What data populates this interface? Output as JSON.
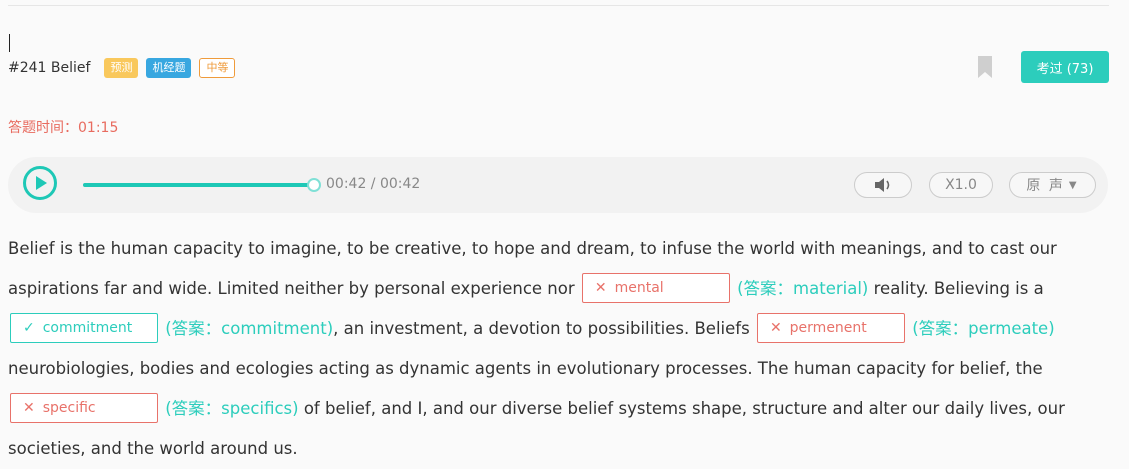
{
  "question": {
    "title": "#241 Belief",
    "tags": {
      "predict": "预测",
      "machine": "机经题",
      "level": "中等"
    },
    "exam_button": "考过 (73)"
  },
  "timer": "答题时间：01:15",
  "player": {
    "time": "00:42 / 00:42",
    "progress": 1.0,
    "speed": "X1.0",
    "voice": "原 声",
    "icons": {
      "play": "play-icon",
      "volume": "volume-icon",
      "dropdown": "chevron-down-icon"
    }
  },
  "passage": {
    "p1": "Belief is the human capacity to imagine, to be creative, to hope and dream, to infuse the world with meanings, and to cast our aspirations far and wide. Limited neither by personal experience nor",
    "p2": "reality. Believing is a",
    "p3": ", an investment, a devotion to possibilities. Beliefs",
    "p4": "neurobiologies, bodies and ecologies acting as dynamic agents in evolutionary processes. The human capacity for belief, the",
    "p5": "of belief, and I, and our diverse belief systems shape, structure and alter our daily lives, our societies, and the world around us.",
    "blanks": [
      {
        "value": "mental",
        "mark": "✕",
        "correct": false,
        "answer": "(答案：material)"
      },
      {
        "value": "commitment",
        "mark": "✓",
        "correct": true,
        "answer": "(答案：commitment)"
      },
      {
        "value": "permenent",
        "mark": "✕",
        "correct": false,
        "answer": "(答案：permeate)"
      },
      {
        "value": "specific",
        "mark": "✕",
        "correct": false,
        "answer": "(答案：specifics)"
      }
    ]
  },
  "colors": {
    "accent": "#2ccdbc",
    "error": "#e8726a",
    "tag_predict": "#f9c85c",
    "tag_machine": "#38a7e0",
    "tag_level": "#ef9b3b"
  }
}
